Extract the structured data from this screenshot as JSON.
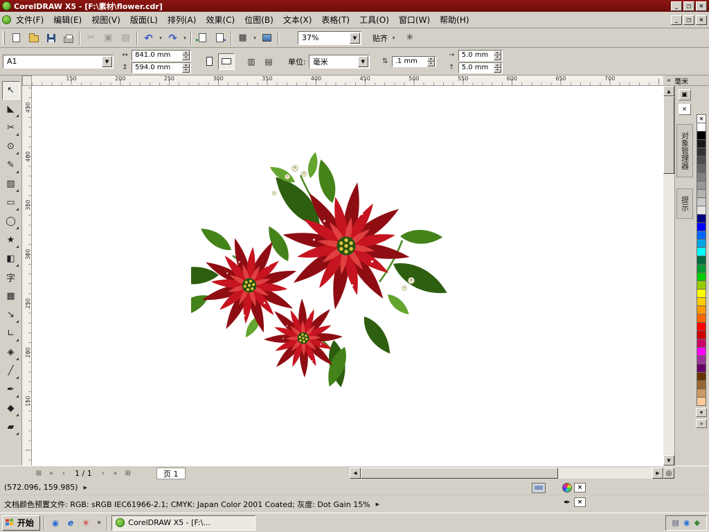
{
  "titlebar": {
    "title": "CorelDRAW X5 - [F:\\素材\\flower.cdr]"
  },
  "window_controls": {
    "minimize": "_",
    "restore": "◳",
    "close": "×"
  },
  "menubar": {
    "items": [
      "文件(F)",
      "编辑(E)",
      "视图(V)",
      "版面(L)",
      "排列(A)",
      "效果(C)",
      "位图(B)",
      "文本(X)",
      "表格(T)",
      "工具(O)",
      "窗口(W)",
      "帮助(H)"
    ]
  },
  "toolbar": {
    "cut_glyph": "✂",
    "copy_glyph": "▣",
    "paste_glyph": "▤",
    "undo_glyph": "↶",
    "redo_glyph": "↷",
    "launcher_glyph": "▦",
    "options_glyph": "✳",
    "dropdown_glyph": "▾",
    "zoom_value": "37%",
    "snap_label": "贴齐"
  },
  "propbar": {
    "preset": "A1",
    "width": "841.0 mm",
    "height": "594.0 mm",
    "width_icon": "↔",
    "height_icon": "↕",
    "apply_all_glyph": "▥",
    "apply_current_glyph": "▤",
    "units_label": "单位:",
    "units_value": "毫米",
    "nudge_icon": "⇅",
    "nudge_value": ".1 mm",
    "dup_x_icon": "→",
    "dup_y_icon": "↑",
    "duplicate_x": "5.0 mm",
    "duplicate_y": "5.0 mm"
  },
  "rulers": {
    "h_ticks": [
      "150",
      "200",
      "250",
      "300",
      "350",
      "400",
      "450",
      "500",
      "550",
      "600",
      "650",
      "700"
    ],
    "v_ticks": [
      "450",
      "400",
      "350",
      "300",
      "250",
      "200",
      "150"
    ],
    "unit_label": "毫米",
    "collapse_glyph": "«"
  },
  "toolbox": {
    "tools": [
      {
        "name": "pick-tool",
        "glyph": "↖",
        "active": true,
        "flyout": false
      },
      {
        "name": "shape-tool",
        "glyph": "◣",
        "flyout": true
      },
      {
        "name": "crop-tool",
        "glyph": "✂",
        "flyout": true
      },
      {
        "name": "zoom-tool",
        "glyph": "⊙",
        "flyout": true
      },
      {
        "name": "freehand-tool",
        "glyph": "✎",
        "flyout": true
      },
      {
        "name": "smart-fill-tool",
        "glyph": "▨",
        "flyout": true
      },
      {
        "name": "rectangle-tool",
        "glyph": "▭",
        "flyout": true
      },
      {
        "name": "ellipse-tool",
        "glyph": "◯",
        "flyout": true
      },
      {
        "name": "polygon-tool",
        "glyph": "★",
        "flyout": true
      },
      {
        "name": "basic-shapes-tool",
        "glyph": "◧",
        "flyout": true
      },
      {
        "name": "text-tool",
        "glyph": "字",
        "flyout": false
      },
      {
        "name": "table-tool",
        "glyph": "▦",
        "flyout": false
      },
      {
        "name": "dimension-tool",
        "glyph": "↘",
        "flyout": true
      },
      {
        "name": "connector-tool",
        "glyph": "∟",
        "flyout": true
      },
      {
        "name": "blend-tool",
        "glyph": "◈",
        "flyout": true
      },
      {
        "name": "eyedropper-tool",
        "glyph": "╱",
        "flyout": true
      },
      {
        "name": "outline-pen-tool",
        "glyph": "✒",
        "flyout": true
      },
      {
        "name": "fill-tool",
        "glyph": "◆",
        "flyout": true
      },
      {
        "name": "interactive-fill-tool",
        "glyph": "▰",
        "flyout": true
      }
    ]
  },
  "palette": {
    "none_glyph": "×",
    "colors": [
      "#FFFFFF",
      "#000000",
      "#1A1A1A",
      "#333333",
      "#4D4D4D",
      "#666666",
      "#808080",
      "#999999",
      "#B3B3B3",
      "#CCCCCC",
      "#E6E6E6",
      "#000080",
      "#0000FF",
      "#0066FF",
      "#00A5E6",
      "#00FFFF",
      "#006B3C",
      "#009933",
      "#00CC00",
      "#99CC00",
      "#FFFF00",
      "#FFCC00",
      "#FF9900",
      "#FF6600",
      "#FF0000",
      "#CC0000",
      "#CC0066",
      "#FF00FF",
      "#993399",
      "#660066",
      "#663300",
      "#996633",
      "#CC9966",
      "#FFCC99"
    ],
    "scroll_down_glyph": "▾",
    "flyout_glyph": "»"
  },
  "dockers": {
    "tabs": [
      "对象管理器",
      "提示"
    ],
    "close_glyph": "×",
    "docker_glyph": "▣"
  },
  "scroll": {
    "up": "▲",
    "down": "▼",
    "left": "◀",
    "right": "▶"
  },
  "pagebar": {
    "add_page_glyph": "⊞",
    "first_glyph": "«",
    "prev_glyph": "‹",
    "page_info": "1 / 1",
    "next_glyph": "›",
    "last_glyph": "»",
    "tab_label": "页 1",
    "navigator_glyph": "◎"
  },
  "statusbar": {
    "coordinates": "(572.096, 159.985)",
    "profile": "文档颜色预置文件: RGB: sRGB IEC61966-2.1; CMYK: Japan Color 2001 Coated; 灰度: Dot Gain 15%",
    "flyout_glyph": "▶",
    "fill_none_glyph": "×",
    "outline_glyph": "✒",
    "outline_none_glyph": "×"
  },
  "taskbar": {
    "start_label": "开始",
    "quick_launch": [
      {
        "name": "media-player-icon",
        "glyph": "◉",
        "color": "#2a6fd6"
      },
      {
        "name": "internet-explorer-icon",
        "glyph": "e",
        "color": "#1e66c8"
      },
      {
        "name": "corel-app-icon",
        "glyph": "✳",
        "color": "#cc2222"
      }
    ],
    "overflow_glyph": "»",
    "task_button_label": "CorelDRAW X5 - [F:\\...",
    "tray_icons": [
      {
        "name": "input-indicator-icon",
        "glyph": "▤",
        "color": "#555577"
      },
      {
        "name": "network-icon",
        "glyph": "◉",
        "color": "#2a6fd6"
      },
      {
        "name": "volume-icon",
        "glyph": "◆",
        "color": "#3a8a3a"
      }
    ]
  }
}
